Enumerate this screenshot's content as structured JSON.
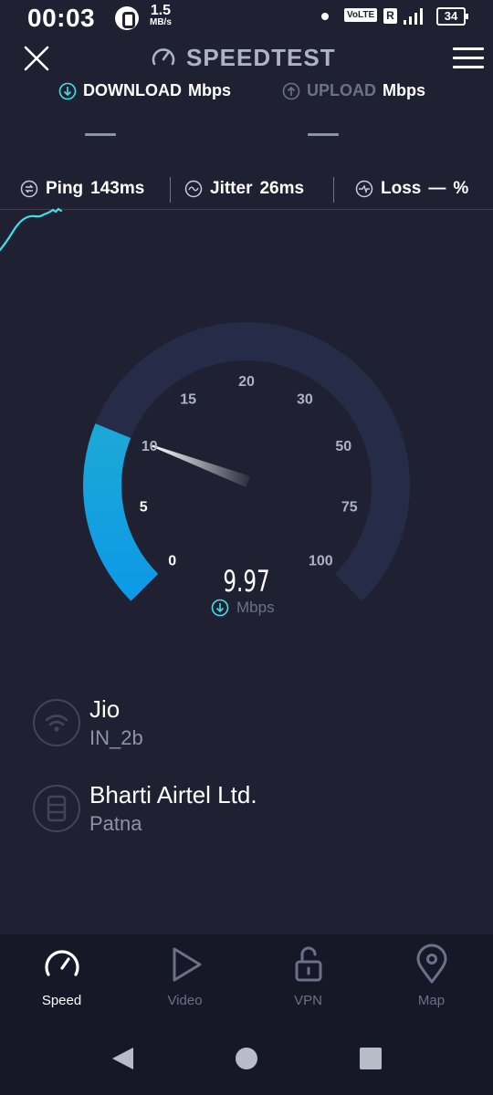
{
  "status": {
    "time": "00:03",
    "net_speed_value": "1.5",
    "net_speed_unit": "MB/s",
    "volte": "VoLTE",
    "roaming": "R",
    "battery": "34"
  },
  "header": {
    "title": "SPEEDTEST",
    "close_icon": "close-icon",
    "menu_icon": "hamburger-menu-icon"
  },
  "tabs": {
    "download": {
      "label": "DOWNLOAD",
      "unit": "Mbps",
      "value": "—"
    },
    "upload": {
      "label": "UPLOAD",
      "unit": "Mbps",
      "value": "—"
    }
  },
  "metrics": {
    "ping": {
      "label": "Ping",
      "value": "143ms"
    },
    "jitter": {
      "label": "Jitter",
      "value": "26ms"
    },
    "loss": {
      "label": "Loss",
      "value": "—",
      "unit": "%"
    }
  },
  "gauge": {
    "ticks": [
      "0",
      "5",
      "10",
      "15",
      "20",
      "30",
      "50",
      "75",
      "100"
    ],
    "current_value": "9.97",
    "current_value_number": 9.97,
    "unit": "Mbps",
    "colors": {
      "track": "#262c47",
      "fill_start": "#1ca8d6",
      "fill_end": "#0d9ae6",
      "accent": "#3fe0e6"
    }
  },
  "provider": {
    "name": "Jio",
    "detail": "IN_2b"
  },
  "server": {
    "name": "Bharti Airtel Ltd.",
    "location": "Patna"
  },
  "nav": {
    "items": [
      {
        "label": "Speed",
        "icon": "speedometer-icon",
        "active": true
      },
      {
        "label": "Video",
        "icon": "play-icon",
        "active": false
      },
      {
        "label": "VPN",
        "icon": "padlock-icon",
        "active": false
      },
      {
        "label": "Map",
        "icon": "map-pin-icon",
        "active": false
      }
    ]
  }
}
